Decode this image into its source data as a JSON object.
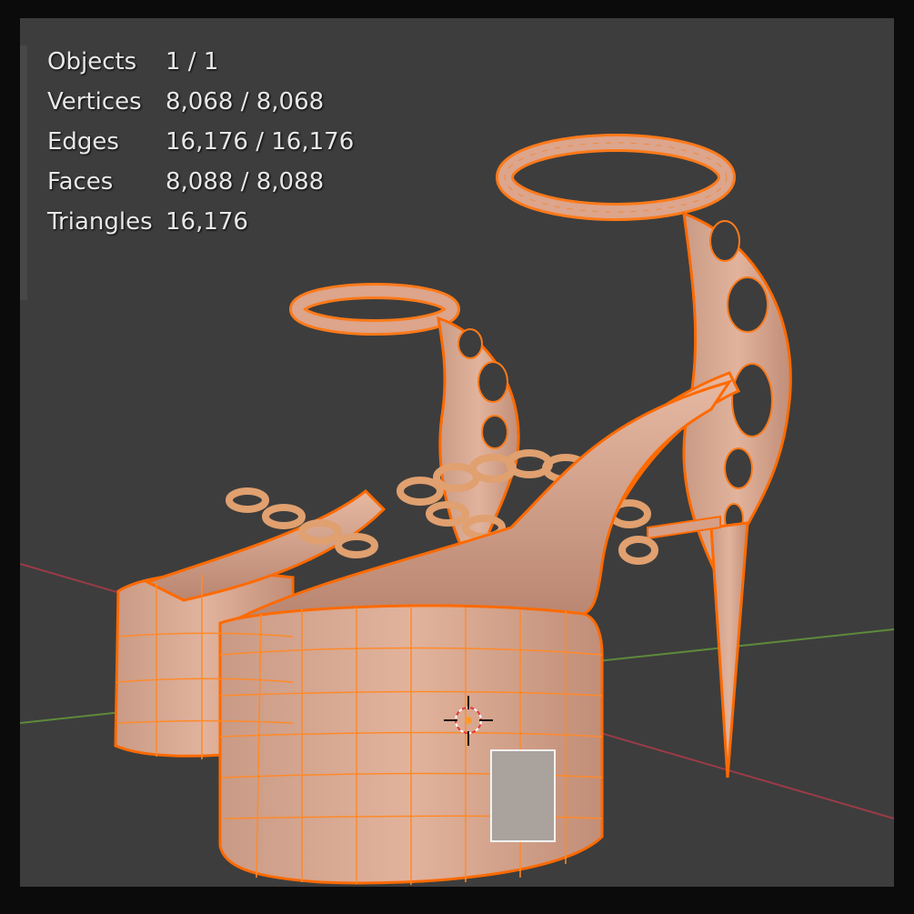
{
  "viewport": {
    "background": "#3d3d3d",
    "mesh_color": "#d9a68e",
    "wire_color": "#ff7a1a",
    "axis_x_color": "#9b3b47",
    "axis_y_color": "#5e8a3a",
    "cursor_icon": "3d-cursor-icon"
  },
  "stats": [
    {
      "label": "Objects",
      "value": "1 / 1"
    },
    {
      "label": "Vertices",
      "value": "8,068 / 8,068"
    },
    {
      "label": "Edges",
      "value": "16,176 / 16,176"
    },
    {
      "label": "Faces",
      "value": "8,088 / 8,088"
    },
    {
      "label": "Triangles",
      "value": "16,176"
    }
  ]
}
